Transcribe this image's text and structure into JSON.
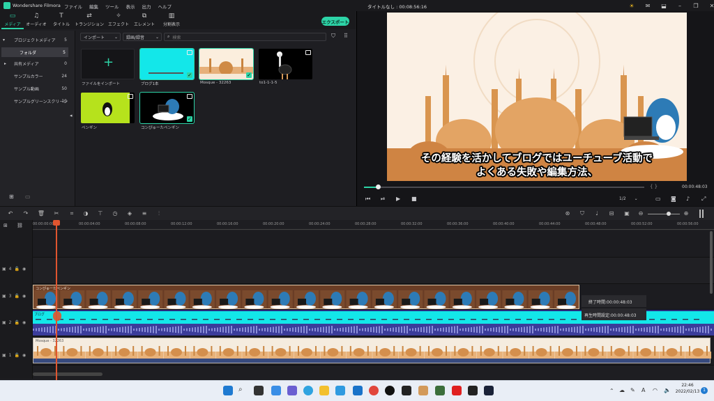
{
  "app": {
    "title": "Wondershare Filmora",
    "document_title": "タイトルなし : 00:08:56:16",
    "menu": [
      "ファイル",
      "編集",
      "ツール",
      "表示",
      "出力",
      "ヘルプ"
    ]
  },
  "toolbar": {
    "tabs": [
      "メディア",
      "オーディオ",
      "タイトル",
      "トランジション",
      "エフェクト",
      "エレメント",
      "分割表示"
    ],
    "active_tab": "メディア",
    "export_label": "エクスポート"
  },
  "sidebar": {
    "items": [
      {
        "label": "プロジェクトメディア",
        "count": "5"
      },
      {
        "label": "フォルダ",
        "count": "5"
      },
      {
        "label": "共有メディア",
        "count": "0"
      },
      {
        "label": "サンプルカラー",
        "count": "24"
      },
      {
        "label": "サンプル動画",
        "count": "50"
      },
      {
        "label": "サンプルグリーンスクリーン",
        "count": "10"
      }
    ]
  },
  "media": {
    "import_dropdown": "インポート",
    "sort_dropdown": "録画/録音",
    "search_placeholder": "検索",
    "import_tile_label": "ファイルをインポート",
    "items": [
      "ブログ1本",
      "Mosque - 32263",
      "to1-1-1-5",
      "ペンギン",
      "コンぴゅーたペンギン"
    ]
  },
  "preview": {
    "subtitle_line1": "その経験を活かしてブログではユーチューブ活動で",
    "subtitle_line2": "よくある失敗や編集方法、",
    "timecode": "00:00:48:03",
    "scale": "1/2",
    "progress": 0.05
  },
  "timeline": {
    "ticks": [
      "00:00:00:00",
      "00:00:04:00",
      "00:00:08:00",
      "00:00:12:00",
      "00:00:16:00",
      "00:00:20:00",
      "00:00:24:00",
      "00:00:28:00",
      "00:00:32:00",
      "00:00:36:00",
      "00:00:40:00",
      "00:00:44:00",
      "00:00:48:00",
      "00:00:52:00",
      "00:00:56:00"
    ],
    "clips": {
      "video_clip": "コンぴゅーたペンギン",
      "text_clip": "ブログ",
      "audio_clip": "Mosque - 32263"
    },
    "tooltip": {
      "end_time": "終了時間:00:00:48:03",
      "duration": "再生時間設定:00:00:48:03"
    },
    "track_numbers": [
      "4",
      "3",
      "2",
      "1"
    ]
  },
  "taskbar": {
    "time": "22:46",
    "date": "2022/02/13",
    "ime": "A",
    "notification_count": "1"
  }
}
